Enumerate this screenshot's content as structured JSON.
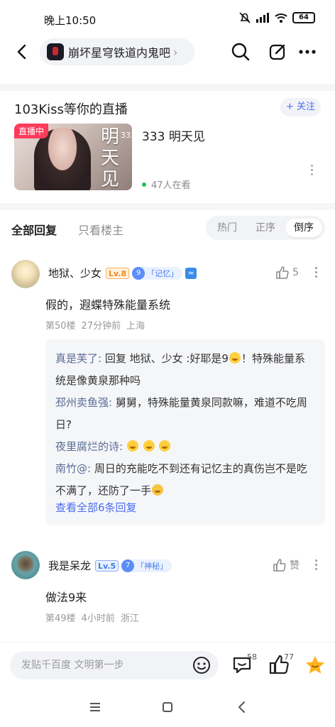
{
  "status": {
    "time": "晚上10:50",
    "battery": "64"
  },
  "nav": {
    "forum_name": "崩坏星穹铁道内鬼吧",
    "chevron": "›"
  },
  "live": {
    "section_title": "103Kiss等你的直播",
    "follow_label": "+ 关注",
    "badge": "直播中",
    "cover_text": "明天见",
    "cover_number": "333",
    "room_title": "333 明天见",
    "viewers": "47人在看"
  },
  "tabs": {
    "all_replies": "全部回复",
    "op_only": "只看楼主",
    "sort_hot": "热门",
    "sort_asc": "正序",
    "sort_desc": "倒序",
    "active_sort": "倒序"
  },
  "posts": [
    {
      "author": "地狱、少女",
      "level": "Lv.8",
      "title_num": "9",
      "title_name": "「记忆」",
      "like_count": "5",
      "content": "假的，遐蝶特殊能量系统",
      "floor": "第50楼",
      "time": "27分钟前",
      "location": "上海",
      "sub_replies": [
        {
          "name": "真是芙了:",
          "text": " 回复 地狱、少女 :好耶是9",
          "emoji_count": 1,
          "tail": "！特殊能量系统是像黄泉那种吗"
        },
        {
          "name": "邳州卖鱼强:",
          "text": " 舅舅，特殊能量黄泉同款嘛，难道不吃周日?",
          "emoji_count": 0,
          "tail": ""
        },
        {
          "name": "夜里腐烂的诗:",
          "text": " ",
          "emoji_count": 3,
          "tail": ""
        },
        {
          "name": "南竹@:",
          "text": " 周日的充能吃不到还有记忆主的真伤岂不是吃不满了，还防了一手",
          "emoji_count": 1,
          "tail": ""
        }
      ],
      "view_all": "查看全部6条回复"
    },
    {
      "author": "我是呆龙",
      "level": "Lv.5",
      "title_num": "7",
      "title_name": "「神秘」",
      "like_label": "赞",
      "content": "做法9来",
      "floor": "第49楼",
      "time": "4小时前",
      "location": "浙江"
    }
  ],
  "bottom_bar": {
    "input_placeholder": "发贴千百度 文明第一步",
    "comment_count": "58",
    "like_count": "77"
  },
  "colors": {
    "accent": "#4b6cf2",
    "live_red": "#ff3b5c",
    "lv8_orange": "#f08a1c",
    "lv5_blue": "#3b7de0",
    "star_gold": "#ffb21c"
  }
}
